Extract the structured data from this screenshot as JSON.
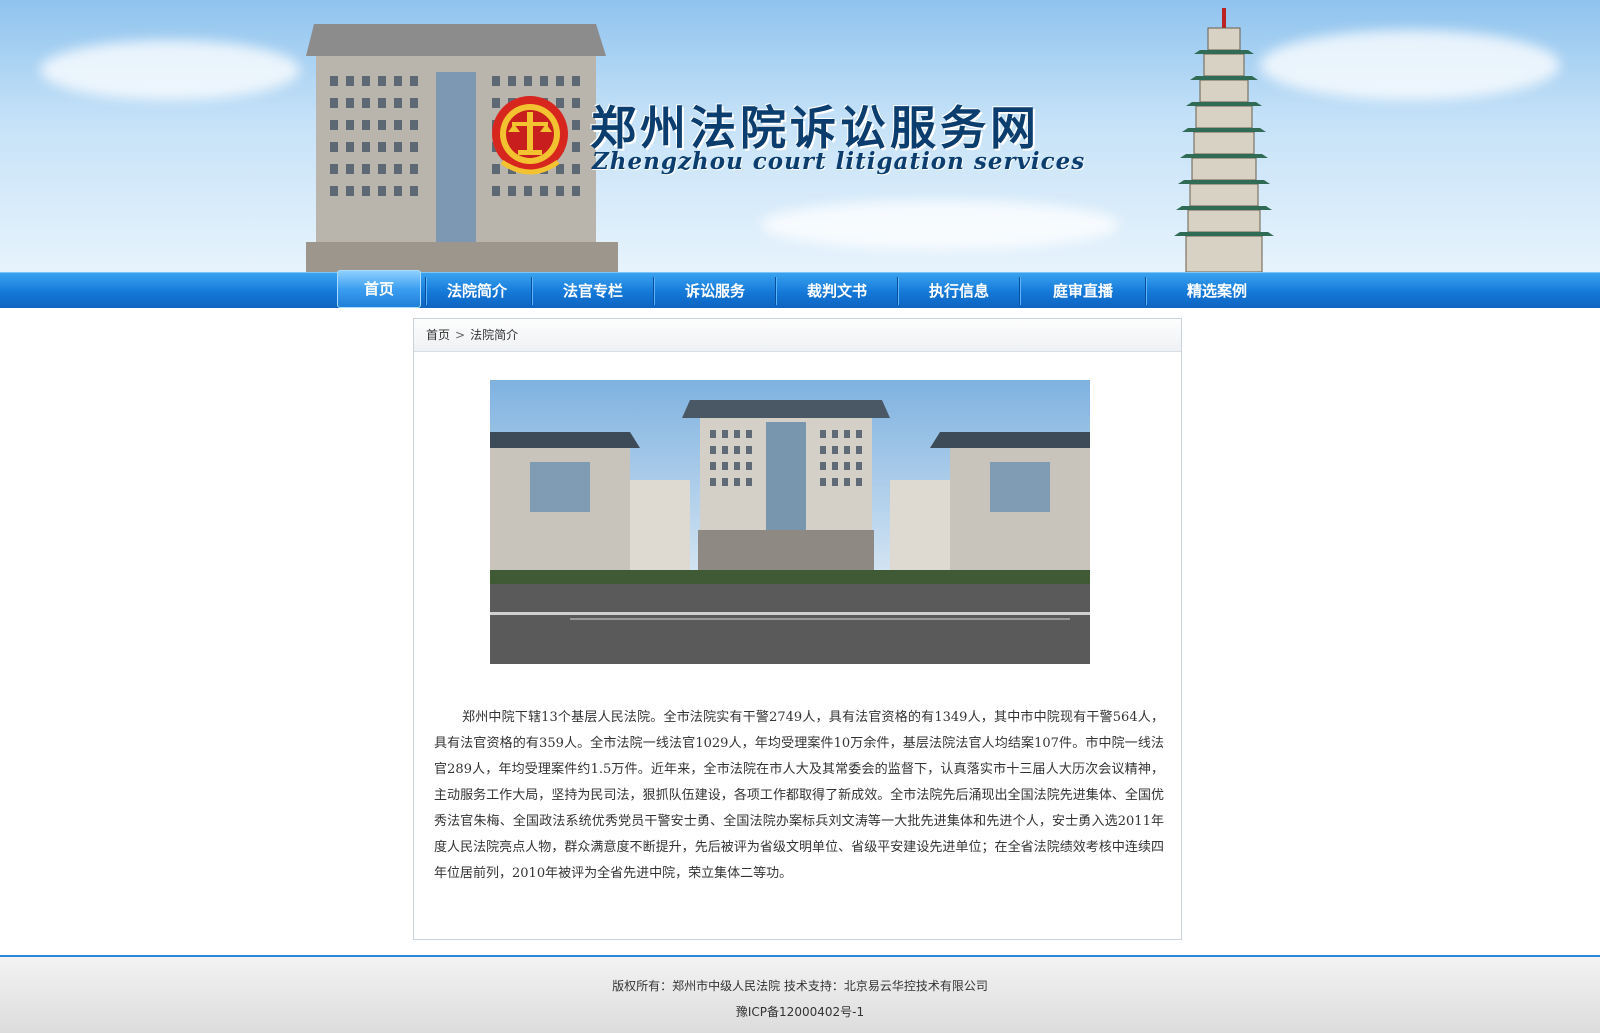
{
  "banner": {
    "title_cn": "郑州法院诉讼服务网",
    "title_en": "Zhengzhou court litigation services",
    "emblem_icon": "court-emblem-icon"
  },
  "nav": {
    "items": [
      {
        "label": "首页",
        "active": true
      },
      {
        "label": "法院简介",
        "active": false
      },
      {
        "label": "法官专栏",
        "active": false
      },
      {
        "label": "诉讼服务",
        "active": false
      },
      {
        "label": "裁判文书",
        "active": false
      },
      {
        "label": "执行信息",
        "active": false
      },
      {
        "label": "庭审直播",
        "active": false
      },
      {
        "label": "精选案例",
        "active": false
      }
    ]
  },
  "breadcrumb": {
    "home": "首页",
    "separator": ">",
    "current": "法院简介"
  },
  "intro": {
    "text": "郑州中院下辖13个基层人民法院。全市法院实有干警2749人，具有法官资格的有1349人，其中市中院现有干警564人，具有法官资格的有359人。全市法院一线法官1029人，年均受理案件10万余件，基层法院法官人均结案107件。市中院一线法官289人，年均受理案件约1.5万件。近年来，全市法院在市人大及其常委会的监督下，认真落实市十三届人大历次会议精神，主动服务工作大局，坚持为民司法，狠抓队伍建设，各项工作都取得了新成效。全市法院先后涌现出全国法院先进集体、全国优秀法官朱梅、全国政法系统优秀党员干警安士勇、全国法院办案标兵刘文涛等一大批先进集体和先进个人，安士勇入选2011年度人民法院亮点人物，群众满意度不断提升，先后被评为省级文明单位、省级平安建设先进单位；在全省法院绩效考核中连续四年位居前列，2010年被评为全省先进中院，荣立集体二等功。"
  },
  "footer": {
    "copyright": "版权所有：郑州市中级人民法院  技术支持：北京易云华控技术有限公司",
    "icp": "豫ICP备12000402号-1"
  },
  "colors": {
    "nav_blue": "#1478d8",
    "title_navy": "#0b3d6e",
    "footer_border": "#2a86d8"
  }
}
